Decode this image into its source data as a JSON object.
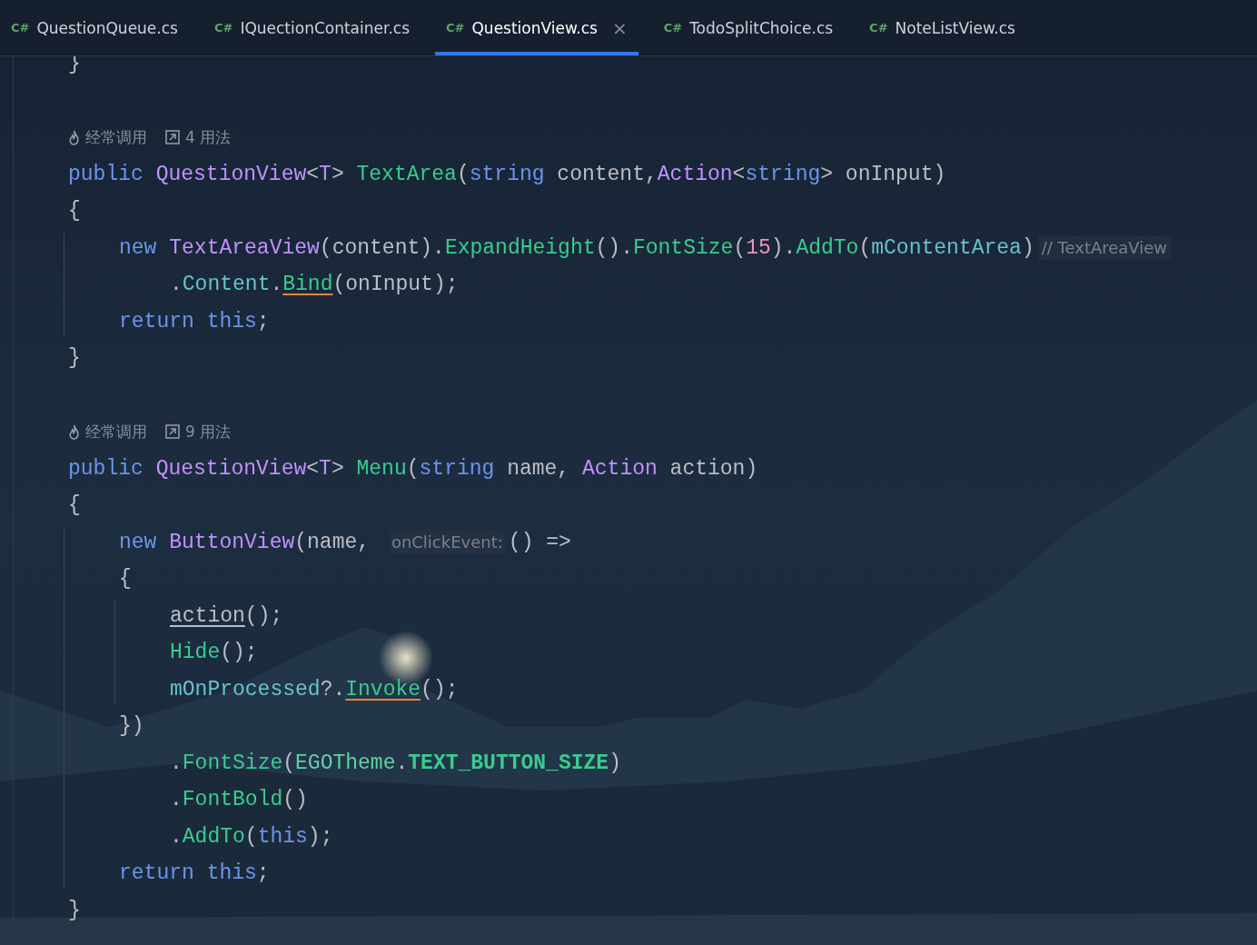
{
  "tabs": [
    {
      "lang": "C#",
      "label": "QuestionQueue.cs",
      "selected": false
    },
    {
      "lang": "C#",
      "label": "IQuectionContainer.cs",
      "selected": false
    },
    {
      "lang": "C#",
      "label": "QuestionView.cs",
      "selected": true,
      "close": "×"
    },
    {
      "lang": "C#",
      "label": "TodoSplitChoice.cs",
      "selected": false
    },
    {
      "lang": "C#",
      "label": "NoteListView.cs",
      "selected": false
    }
  ],
  "code": [
    {
      "kind": "code",
      "tokens": [
        {
          "kind": "plain",
          "text": "}"
        }
      ]
    },
    {
      "kind": "blank"
    },
    {
      "kind": "lens",
      "hint": "经常调用",
      "usages": "4 用法"
    },
    {
      "kind": "code",
      "tokens": [
        {
          "kind": "keyword",
          "text": "public "
        },
        {
          "kind": "type",
          "text": "QuestionView"
        },
        {
          "kind": "plain",
          "text": "<"
        },
        {
          "kind": "type",
          "text": "T"
        },
        {
          "kind": "plain",
          "text": "> "
        },
        {
          "kind": "method",
          "text": "TextArea"
        },
        {
          "kind": "plain",
          "text": "("
        },
        {
          "kind": "keyword",
          "text": "string "
        },
        {
          "kind": "plain",
          "text": "content,"
        },
        {
          "kind": "type",
          "text": "Action"
        },
        {
          "kind": "plain",
          "text": "<"
        },
        {
          "kind": "keyword",
          "text": "string"
        },
        {
          "kind": "plain",
          "text": "> onInput)"
        }
      ]
    },
    {
      "kind": "code",
      "tokens": [
        {
          "kind": "plain",
          "text": "{"
        }
      ],
      "guide": true,
      "children": [
        {
          "kind": "code",
          "tokens": [
            {
              "kind": "keyword",
              "text": "new "
            },
            {
              "kind": "type",
              "text": "TextAreaView"
            },
            {
              "kind": "plain",
              "text": "(content)."
            },
            {
              "kind": "method",
              "text": "ExpandHeight"
            },
            {
              "kind": "plain",
              "text": "()."
            },
            {
              "kind": "method",
              "text": "FontSize"
            },
            {
              "kind": "plain",
              "text": "("
            },
            {
              "kind": "number",
              "text": "15"
            },
            {
              "kind": "plain",
              "text": ")."
            },
            {
              "kind": "method",
              "text": "AddTo"
            },
            {
              "kind": "plain",
              "text": "("
            },
            {
              "kind": "field",
              "text": "mContentArea"
            },
            {
              "kind": "plain",
              "text": ")"
            },
            {
              "kind": "comment",
              "text": "// TextAreaView"
            }
          ],
          "guide": false,
          "children": [
            {
              "kind": "code",
              "tokens": [
                {
                  "kind": "plain",
                  "text": "."
                },
                {
                  "kind": "field",
                  "text": "Content"
                },
                {
                  "kind": "plain",
                  "text": "."
                },
                {
                  "kind": "method",
                  "text": "Bind",
                  "underline": true,
                  "warning": true
                },
                {
                  "kind": "plain",
                  "text": "(onInput);"
                }
              ]
            }
          ]
        },
        {
          "kind": "code",
          "tokens": [
            {
              "kind": "keyword",
              "text": "return "
            },
            {
              "kind": "keyword",
              "text": "this"
            },
            {
              "kind": "plain",
              "text": ";"
            }
          ]
        }
      ]
    },
    {
      "kind": "code",
      "tokens": [
        {
          "kind": "plain",
          "text": "}"
        }
      ]
    },
    {
      "kind": "blank"
    },
    {
      "kind": "lens",
      "hint": "经常调用",
      "usages": "9 用法"
    },
    {
      "kind": "code",
      "tokens": [
        {
          "kind": "keyword",
          "text": "public "
        },
        {
          "kind": "type",
          "text": "QuestionView"
        },
        {
          "kind": "plain",
          "text": "<"
        },
        {
          "kind": "type",
          "text": "T"
        },
        {
          "kind": "plain",
          "text": "> "
        },
        {
          "kind": "method",
          "text": "Menu"
        },
        {
          "kind": "plain",
          "text": "("
        },
        {
          "kind": "keyword",
          "text": "string "
        },
        {
          "kind": "plain",
          "text": "name, "
        },
        {
          "kind": "type",
          "text": "Action "
        },
        {
          "kind": "plain",
          "text": "action)"
        }
      ]
    },
    {
      "kind": "code",
      "tokens": [
        {
          "kind": "plain",
          "text": "{"
        }
      ],
      "guide": true,
      "children": [
        {
          "kind": "code",
          "tokens": [
            {
              "kind": "keyword",
              "text": "new "
            },
            {
              "kind": "type",
              "text": "ButtonView"
            },
            {
              "kind": "plain",
              "text": "(name, "
            },
            {
              "kind": "hint",
              "text": "onClickEvent:"
            },
            {
              "kind": "plain",
              "text": "() =>"
            }
          ]
        },
        {
          "kind": "code",
          "tokens": [
            {
              "kind": "plain",
              "text": "{"
            }
          ],
          "guide": true,
          "children": [
            {
              "kind": "code",
              "tokens": [
                {
                  "kind": "plain",
                  "text": "action",
                  "underline": true,
                  "warning": false
                },
                {
                  "kind": "plain",
                  "text": "();"
                }
              ]
            },
            {
              "kind": "code",
              "tokens": [
                {
                  "kind": "method",
                  "text": "Hide"
                },
                {
                  "kind": "plain",
                  "text": "();"
                }
              ]
            },
            {
              "kind": "code",
              "tokens": [
                {
                  "kind": "field",
                  "text": "mOnProcessed"
                },
                {
                  "kind": "plain",
                  "text": "?."
                },
                {
                  "kind": "method",
                  "text": "Invoke",
                  "underline": true,
                  "warning": true
                },
                {
                  "kind": "plain",
                  "text": "();"
                }
              ]
            }
          ]
        },
        {
          "kind": "code",
          "tokens": [
            {
              "kind": "plain",
              "text": "})"
            }
          ],
          "guide": false,
          "children": [
            {
              "kind": "code",
              "tokens": [
                {
                  "kind": "plain",
                  "text": "."
                },
                {
                  "kind": "method",
                  "text": "FontSize"
                },
                {
                  "kind": "plain",
                  "text": "("
                },
                {
                  "kind": "class",
                  "text": "EGOTheme"
                },
                {
                  "kind": "plain",
                  "text": "."
                },
                {
                  "kind": "constant",
                  "text": "TEXT_BUTTON_SIZE"
                },
                {
                  "kind": "plain",
                  "text": ")"
                }
              ]
            },
            {
              "kind": "code",
              "tokens": [
                {
                  "kind": "plain",
                  "text": "."
                },
                {
                  "kind": "method",
                  "text": "FontBold"
                },
                {
                  "kind": "plain",
                  "text": "()"
                }
              ]
            },
            {
              "kind": "code",
              "tokens": [
                {
                  "kind": "plain",
                  "text": "."
                },
                {
                  "kind": "method",
                  "text": "AddTo"
                },
                {
                  "kind": "plain",
                  "text": "("
                },
                {
                  "kind": "keyword",
                  "text": "this"
                },
                {
                  "kind": "plain",
                  "text": ");"
                }
              ]
            }
          ]
        },
        {
          "kind": "code",
          "tokens": [
            {
              "kind": "keyword",
              "text": "return "
            },
            {
              "kind": "keyword",
              "text": "this"
            },
            {
              "kind": "plain",
              "text": ";"
            }
          ]
        }
      ]
    },
    {
      "kind": "code",
      "tokens": [
        {
          "kind": "plain",
          "text": "}"
        }
      ]
    }
  ]
}
